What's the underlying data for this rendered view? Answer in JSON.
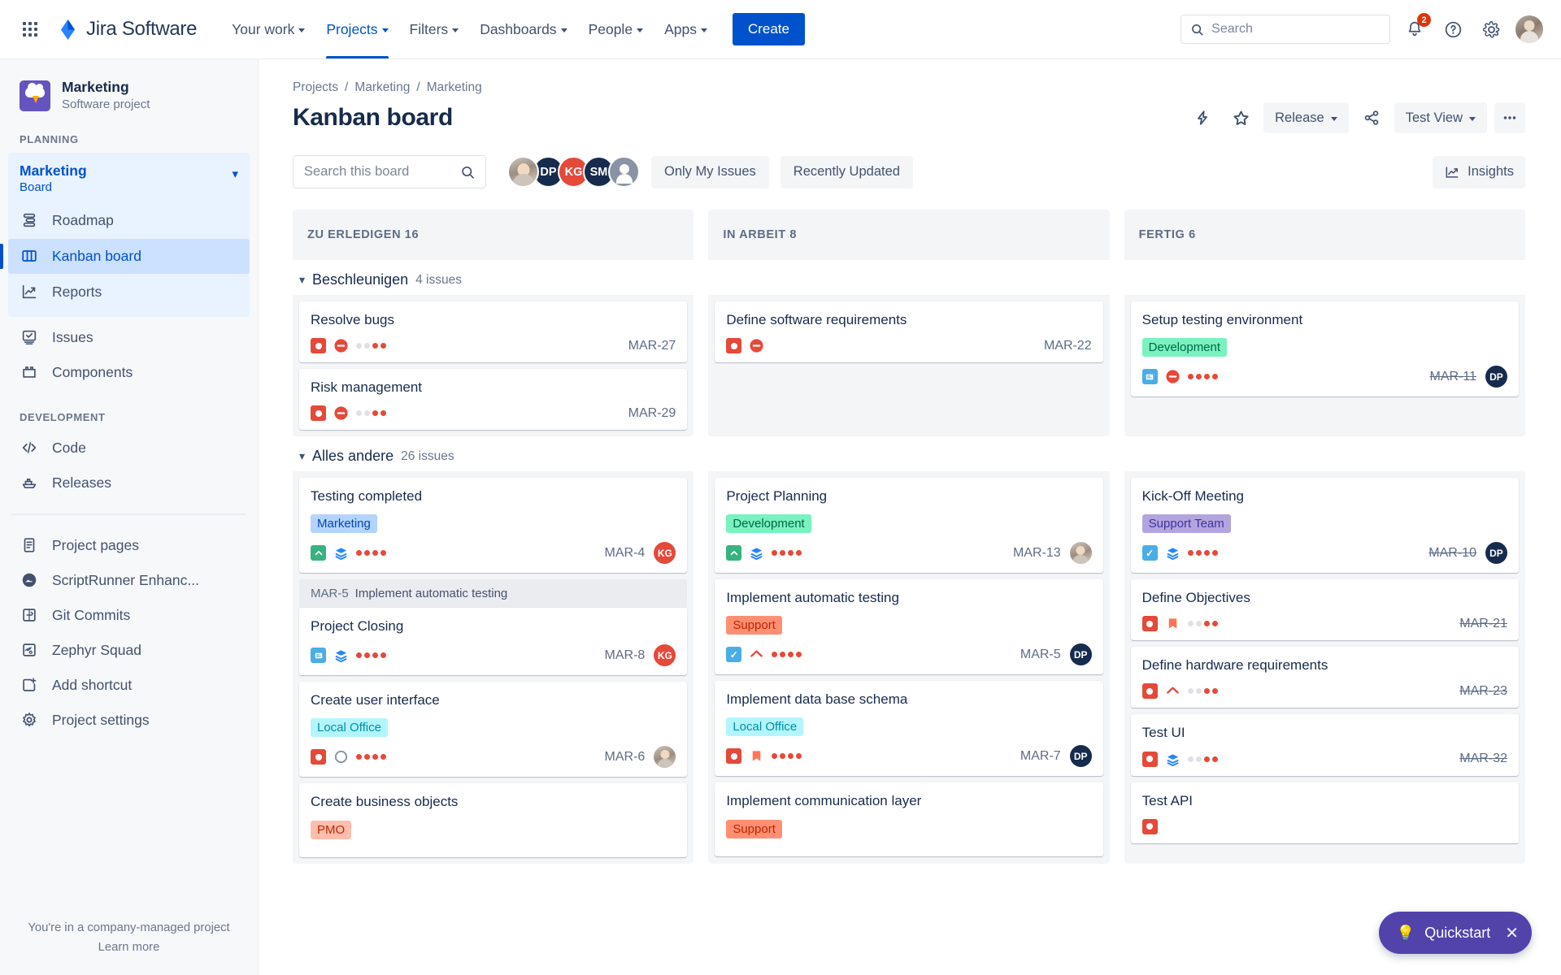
{
  "topnav": {
    "app_switcher_icon": "grid-9-dots-icon",
    "brand": "Jira Software",
    "brand_icon": "jira-logo-icon",
    "items": [
      {
        "label": "Your work",
        "has_caret": true,
        "active": false
      },
      {
        "label": "Projects",
        "has_caret": true,
        "active": true
      },
      {
        "label": "Filters",
        "has_caret": true,
        "active": false
      },
      {
        "label": "Dashboards",
        "has_caret": true,
        "active": false
      },
      {
        "label": "People",
        "has_caret": true,
        "active": false
      },
      {
        "label": "Apps",
        "has_caret": true,
        "active": false
      }
    ],
    "create_label": "Create",
    "search": {
      "placeholder": "Search",
      "value": "",
      "icon": "search-icon"
    },
    "notifications": {
      "icon": "bell-icon",
      "count": "2"
    },
    "help_icon": "help-circle-icon",
    "settings_icon": "gear-icon",
    "profile_icon": "user-avatar"
  },
  "sidebar": {
    "project": {
      "name": "Marketing",
      "subtitle": "Software project",
      "icon": "cloud-lightning-icon"
    },
    "planning_label": "PLANNING",
    "board_group": {
      "title": "Marketing",
      "subtitle": "Board",
      "chevron": "chevron-down-icon"
    },
    "planning_items": [
      {
        "label": "Roadmap",
        "icon": "roadmap-icon",
        "selected": false
      },
      {
        "label": "Kanban board",
        "icon": "board-columns-icon",
        "selected": true
      },
      {
        "label": "Reports",
        "icon": "reports-chart-icon",
        "selected": false
      }
    ],
    "flat_items": [
      {
        "label": "Issues",
        "icon": "issues-icon"
      },
      {
        "label": "Components",
        "icon": "components-icon"
      }
    ],
    "development_label": "DEVELOPMENT",
    "dev_items": [
      {
        "label": "Code",
        "icon": "code-brackets-icon"
      },
      {
        "label": "Releases",
        "icon": "releases-ship-icon"
      }
    ],
    "apps_items": [
      {
        "label": "Project pages",
        "icon": "page-document-icon"
      },
      {
        "label": "ScriptRunner Enhanc...",
        "icon": "scriptrunner-shoe-icon"
      },
      {
        "label": "Git Commits",
        "icon": "git-commits-icon"
      },
      {
        "label": "Zephyr Squad",
        "icon": "zephyr-wing-icon"
      },
      {
        "label": "Add shortcut",
        "icon": "add-shortcut-icon"
      },
      {
        "label": "Project settings",
        "icon": "gear-icon"
      }
    ],
    "footer": {
      "line1": "You're in a company-managed project",
      "line2": "Learn more"
    }
  },
  "header": {
    "breadcrumbs": [
      "Projects",
      "Marketing",
      "Marketing"
    ],
    "breadcrumb_separator": "/",
    "title": "Kanban board",
    "tools": {
      "lightning_icon": "lightning-automation-icon",
      "star_icon": "star-icon",
      "release_label": "Release",
      "release_caret": "chevron-down-icon",
      "share_icon": "share-icon",
      "view_label": "Test View",
      "view_caret": "chevron-down-icon",
      "more_icon": "more-horizontal-icon"
    }
  },
  "filterbar": {
    "search": {
      "placeholder": "Search this board",
      "value": "",
      "icon": "search-icon"
    },
    "avatars": [
      {
        "type": "photo",
        "initials": "",
        "color": "#cdc4ba"
      },
      {
        "type": "initials",
        "initials": "DP",
        "color": "#172b4d"
      },
      {
        "type": "initials",
        "initials": "KG",
        "color": "#e5493a"
      },
      {
        "type": "initials",
        "initials": "SM",
        "color": "#172b4d"
      },
      {
        "type": "generic",
        "initials": "",
        "color": "#8993a4"
      }
    ],
    "only_my_issues": "Only My Issues",
    "recently_updated": "Recently Updated",
    "insights": {
      "label": "Insights",
      "icon": "insights-chart-icon"
    }
  },
  "columns": [
    {
      "name": "ZU ERLEDIGEN",
      "count": "16"
    },
    {
      "name": "IN ARBEIT",
      "count": "8"
    },
    {
      "name": "FERTIG",
      "count": "6"
    }
  ],
  "swimlanes": [
    {
      "name": "Beschleunigen",
      "count": "4 issues",
      "chevron": "chevron-down-icon",
      "columns": [
        [
          {
            "title": "Resolve bugs",
            "label": null,
            "type": "bug",
            "priority": "blocker",
            "dots": [
              "#dfe1e6",
              "#dfe1e6",
              "#e5493a",
              "#e5493a"
            ],
            "key": "MAR-27",
            "key_done": false,
            "assignee": null
          },
          {
            "title": "Risk management",
            "label": null,
            "type": "bug",
            "priority": "blocker",
            "dots": [
              "#dfe1e6",
              "#dfe1e6",
              "#e5493a",
              "#e5493a"
            ],
            "key": "MAR-29",
            "key_done": false,
            "assignee": null
          }
        ],
        [
          {
            "title": "Define software requirements",
            "label": null,
            "type": "bug",
            "priority": "blocker",
            "dots": [],
            "key": "MAR-22",
            "key_done": false,
            "assignee": null
          }
        ],
        [
          {
            "title": "Setup testing environment",
            "label": {
              "text": "Development",
              "bg": "#79f2c0",
              "fg": "#006644"
            },
            "type": "sub",
            "priority": "blocker",
            "dots": [
              "#e5493a",
              "#e5493a",
              "#e5493a",
              "#e5493a"
            ],
            "key": "MAR-11",
            "key_done": true,
            "assignee": {
              "initials": "DP",
              "color": "#172b4d",
              "type": "initials"
            }
          }
        ]
      ]
    },
    {
      "name": "Alles andere",
      "count": "26 issues",
      "chevron": "chevron-down-icon",
      "columns": [
        [
          {
            "title": "Testing completed",
            "label": {
              "text": "Marketing",
              "bg": "#b3d4ff",
              "fg": "#0747a6"
            },
            "type": "story-up",
            "priority": "layers",
            "dots": [
              "#e5493a",
              "#e5493a",
              "#e5493a",
              "#e5493a"
            ],
            "key": "MAR-4",
            "key_done": false,
            "assignee": {
              "initials": "KG",
              "color": "#e5493a",
              "type": "initials"
            }
          },
          {
            "title": "Project Closing",
            "label": null,
            "type": "sub",
            "priority": "layers",
            "dots": [
              "#e5493a",
              "#e5493a",
              "#e5493a",
              "#e5493a"
            ],
            "key": "MAR-8",
            "key_done": false,
            "assignee": {
              "initials": "KG",
              "color": "#e5493a",
              "type": "initials"
            },
            "drag_header": {
              "key": "MAR-5",
              "title": "Implement automatic testing"
            }
          },
          {
            "title": "Create user interface",
            "label": {
              "text": "Local Office",
              "bg": "#b3f5ff",
              "fg": "#008da6"
            },
            "type": "bug",
            "priority": "circle",
            "dots": [
              "#e5493a",
              "#e5493a",
              "#e5493a",
              "#e5493a"
            ],
            "key": "MAR-6",
            "key_done": false,
            "assignee": {
              "initials": "",
              "color": "#cdc4ba",
              "type": "photo"
            }
          },
          {
            "title": "Create business objects",
            "label": {
              "text": "PMO",
              "bg": "#ffbdad",
              "fg": "#bf2600"
            },
            "type": null,
            "priority": null,
            "dots": [],
            "key": "",
            "key_done": false,
            "assignee": null
          }
        ],
        [
          {
            "title": "Project Planning",
            "label": {
              "text": "Development",
              "bg": "#79f2c0",
              "fg": "#006644"
            },
            "type": "story-up",
            "priority": "layers",
            "dots": [
              "#e5493a",
              "#e5493a",
              "#e5493a",
              "#e5493a"
            ],
            "key": "MAR-13",
            "key_done": false,
            "assignee": {
              "initials": "",
              "color": "#cdc4ba",
              "type": "photo"
            }
          },
          {
            "title": "Implement automatic testing",
            "label": {
              "text": "Support",
              "bg": "#ff8f73",
              "fg": "#bf2600"
            },
            "type": "task",
            "priority": "up-arrow-thin",
            "dots": [
              "#e5493a",
              "#e5493a",
              "#e5493a",
              "#e5493a"
            ],
            "key": "MAR-5",
            "key_done": false,
            "assignee": {
              "initials": "DP",
              "color": "#172b4d",
              "type": "initials"
            }
          },
          {
            "title": "Implement data base schema",
            "label": {
              "text": "Local Office",
              "bg": "#b3f5ff",
              "fg": "#008da6"
            },
            "type": "bug",
            "priority": "bookmark",
            "dots": [
              "#e5493a",
              "#e5493a",
              "#e5493a",
              "#e5493a"
            ],
            "key": "MAR-7",
            "key_done": false,
            "assignee": {
              "initials": "DP",
              "color": "#172b4d",
              "type": "initials"
            }
          },
          {
            "title": "Implement communication layer",
            "label": {
              "text": "Support",
              "bg": "#ff8f73",
              "fg": "#bf2600"
            },
            "type": null,
            "priority": null,
            "dots": [],
            "key": "",
            "key_done": false,
            "assignee": null
          }
        ],
        [
          {
            "title": "Kick-Off Meeting",
            "label": {
              "text": "Support Team",
              "bg": "#b3a4e0",
              "fg": "#403294"
            },
            "type": "task",
            "priority": "layers",
            "dots": [
              "#e5493a",
              "#e5493a",
              "#e5493a",
              "#e5493a"
            ],
            "key": "MAR-10",
            "key_done": true,
            "assignee": {
              "initials": "DP",
              "color": "#172b4d",
              "type": "initials"
            }
          },
          {
            "title": "Define Objectives",
            "label": null,
            "type": "bug",
            "priority": "bookmark",
            "dots": [
              "#dfe1e6",
              "#dfe1e6",
              "#e5493a",
              "#e5493a"
            ],
            "key": "MAR-21",
            "key_done": true,
            "assignee": null
          },
          {
            "title": "Define hardware requirements",
            "label": null,
            "type": "bug",
            "priority": "up-arrow-thin",
            "dots": [
              "#dfe1e6",
              "#dfe1e6",
              "#e5493a",
              "#e5493a"
            ],
            "key": "MAR-23",
            "key_done": true,
            "assignee": null
          },
          {
            "title": "Test UI",
            "label": null,
            "type": "bug",
            "priority": "layers",
            "dots": [
              "#dfe1e6",
              "#dfe1e6",
              "#e5493a",
              "#e5493a"
            ],
            "key": "MAR-32",
            "key_done": true,
            "assignee": null
          },
          {
            "title": "Test API",
            "label": null,
            "type": "bug",
            "priority": null,
            "dots": [],
            "key": "",
            "key_done": true,
            "assignee": null
          }
        ]
      ]
    }
  ],
  "quickstart": {
    "label": "Quickstart",
    "icon": "lightbulb-icon",
    "close_icon": "close-icon"
  }
}
